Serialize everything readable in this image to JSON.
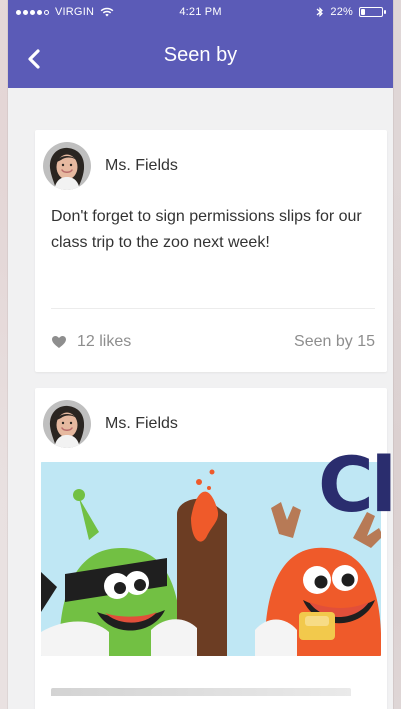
{
  "status_bar": {
    "carrier": "VIRGIN",
    "time": "4:21 PM",
    "battery_percent_text": "22%",
    "battery_level": 0.22,
    "signal_bars_filled": 4,
    "signal_bars_total": 5
  },
  "nav": {
    "title": "Seen by",
    "background": "#5b5bb7"
  },
  "posts": [
    {
      "author": "Ms. Fields",
      "message": "Don't forget to sign permissions slips for our class trip to the zoo next week!",
      "likes_text": "12 likes",
      "seen_text": "Seen by 15"
    },
    {
      "author": "Ms. Fields",
      "has_image": true
    }
  ],
  "overlay": {
    "text": "Cl"
  },
  "icons": {
    "back": "chevron-left-icon",
    "wifi": "wifi-icon",
    "bluetooth": "bluetooth-icon",
    "battery": "battery-icon",
    "like": "heart-icon",
    "avatar": "avatar-photo"
  }
}
